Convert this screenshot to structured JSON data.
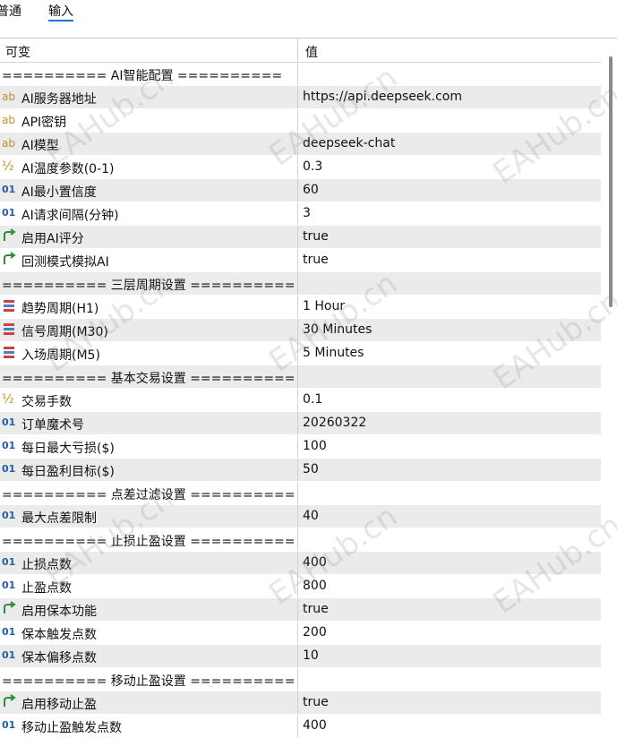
{
  "tabs": [
    {
      "label": "普通"
    },
    {
      "label": "输入"
    }
  ],
  "columns": {
    "name": "可变",
    "value": "值"
  },
  "watermark": "EAHub.cn",
  "rows": [
    {
      "type": "section",
      "name": "========== AI智能配置 ==========",
      "value": ""
    },
    {
      "type": "string",
      "icon": "ab-icon",
      "name": "AI服务器地址",
      "value": "https://api.deepseek.com"
    },
    {
      "type": "string",
      "icon": "ab-icon",
      "name": "API密钥",
      "value": ""
    },
    {
      "type": "string",
      "icon": "ab-icon",
      "name": "AI模型",
      "value": "deepseek-chat"
    },
    {
      "type": "double",
      "icon": "fraction-icon",
      "name": "AI温度参数(0-1)",
      "value": "0.3"
    },
    {
      "type": "int",
      "icon": "integer-icon",
      "name": "AI最小置信度",
      "value": "60"
    },
    {
      "type": "int",
      "icon": "integer-icon",
      "name": "AI请求间隔(分钟)",
      "value": "3"
    },
    {
      "type": "bool",
      "icon": "bool-arrow-icon",
      "name": "启用AI评分",
      "value": "true"
    },
    {
      "type": "bool",
      "icon": "bool-arrow-icon",
      "name": "回测模式模拟AI",
      "value": "true"
    },
    {
      "type": "section",
      "name": "========== 三层周期设置 ==========",
      "value": ""
    },
    {
      "type": "enum",
      "icon": "enum-list-icon",
      "name": "趋势周期(H1)",
      "value": "1 Hour"
    },
    {
      "type": "enum",
      "icon": "enum-list-icon",
      "name": "信号周期(M30)",
      "value": "30 Minutes"
    },
    {
      "type": "enum",
      "icon": "enum-list-icon",
      "name": "入场周期(M5)",
      "value": "5 Minutes"
    },
    {
      "type": "section",
      "name": "========== 基本交易设置 ==========",
      "value": ""
    },
    {
      "type": "double",
      "icon": "fraction-icon",
      "name": "交易手数",
      "value": "0.1"
    },
    {
      "type": "int",
      "icon": "integer-icon",
      "name": "订单魔术号",
      "value": "20260322"
    },
    {
      "type": "int",
      "icon": "integer-icon",
      "name": "每日最大亏损($)",
      "value": "100"
    },
    {
      "type": "int",
      "icon": "integer-icon",
      "name": "每日盈利目标($)",
      "value": "50"
    },
    {
      "type": "section",
      "name": "========== 点差过滤设置 ==========",
      "value": ""
    },
    {
      "type": "int",
      "icon": "integer-icon",
      "name": "最大点差限制",
      "value": "40"
    },
    {
      "type": "section",
      "name": "========== 止损止盈设置 ==========",
      "value": ""
    },
    {
      "type": "int",
      "icon": "integer-icon",
      "name": "止损点数",
      "value": "400"
    },
    {
      "type": "int",
      "icon": "integer-icon",
      "name": "止盈点数",
      "value": "800"
    },
    {
      "type": "bool",
      "icon": "bool-arrow-icon",
      "name": "启用保本功能",
      "value": "true"
    },
    {
      "type": "int",
      "icon": "integer-icon",
      "name": "保本触发点数",
      "value": "200"
    },
    {
      "type": "int",
      "icon": "integer-icon",
      "name": "保本偏移点数",
      "value": "10"
    },
    {
      "type": "section",
      "name": "========== 移动止盈设置 ==========",
      "value": ""
    },
    {
      "type": "bool",
      "icon": "bool-arrow-icon",
      "name": "启用移动止盈",
      "value": "true"
    },
    {
      "type": "int",
      "icon": "integer-icon",
      "name": "移动止盈触发点数",
      "value": "400"
    }
  ],
  "colors": {
    "accent": "#1a73d9",
    "shade": "#ebebeb",
    "int_icon": "#1f5fa8",
    "str_icon": "#c8901a",
    "bool_icon": "#2e8b3a",
    "enum_icon": "#d04040"
  }
}
